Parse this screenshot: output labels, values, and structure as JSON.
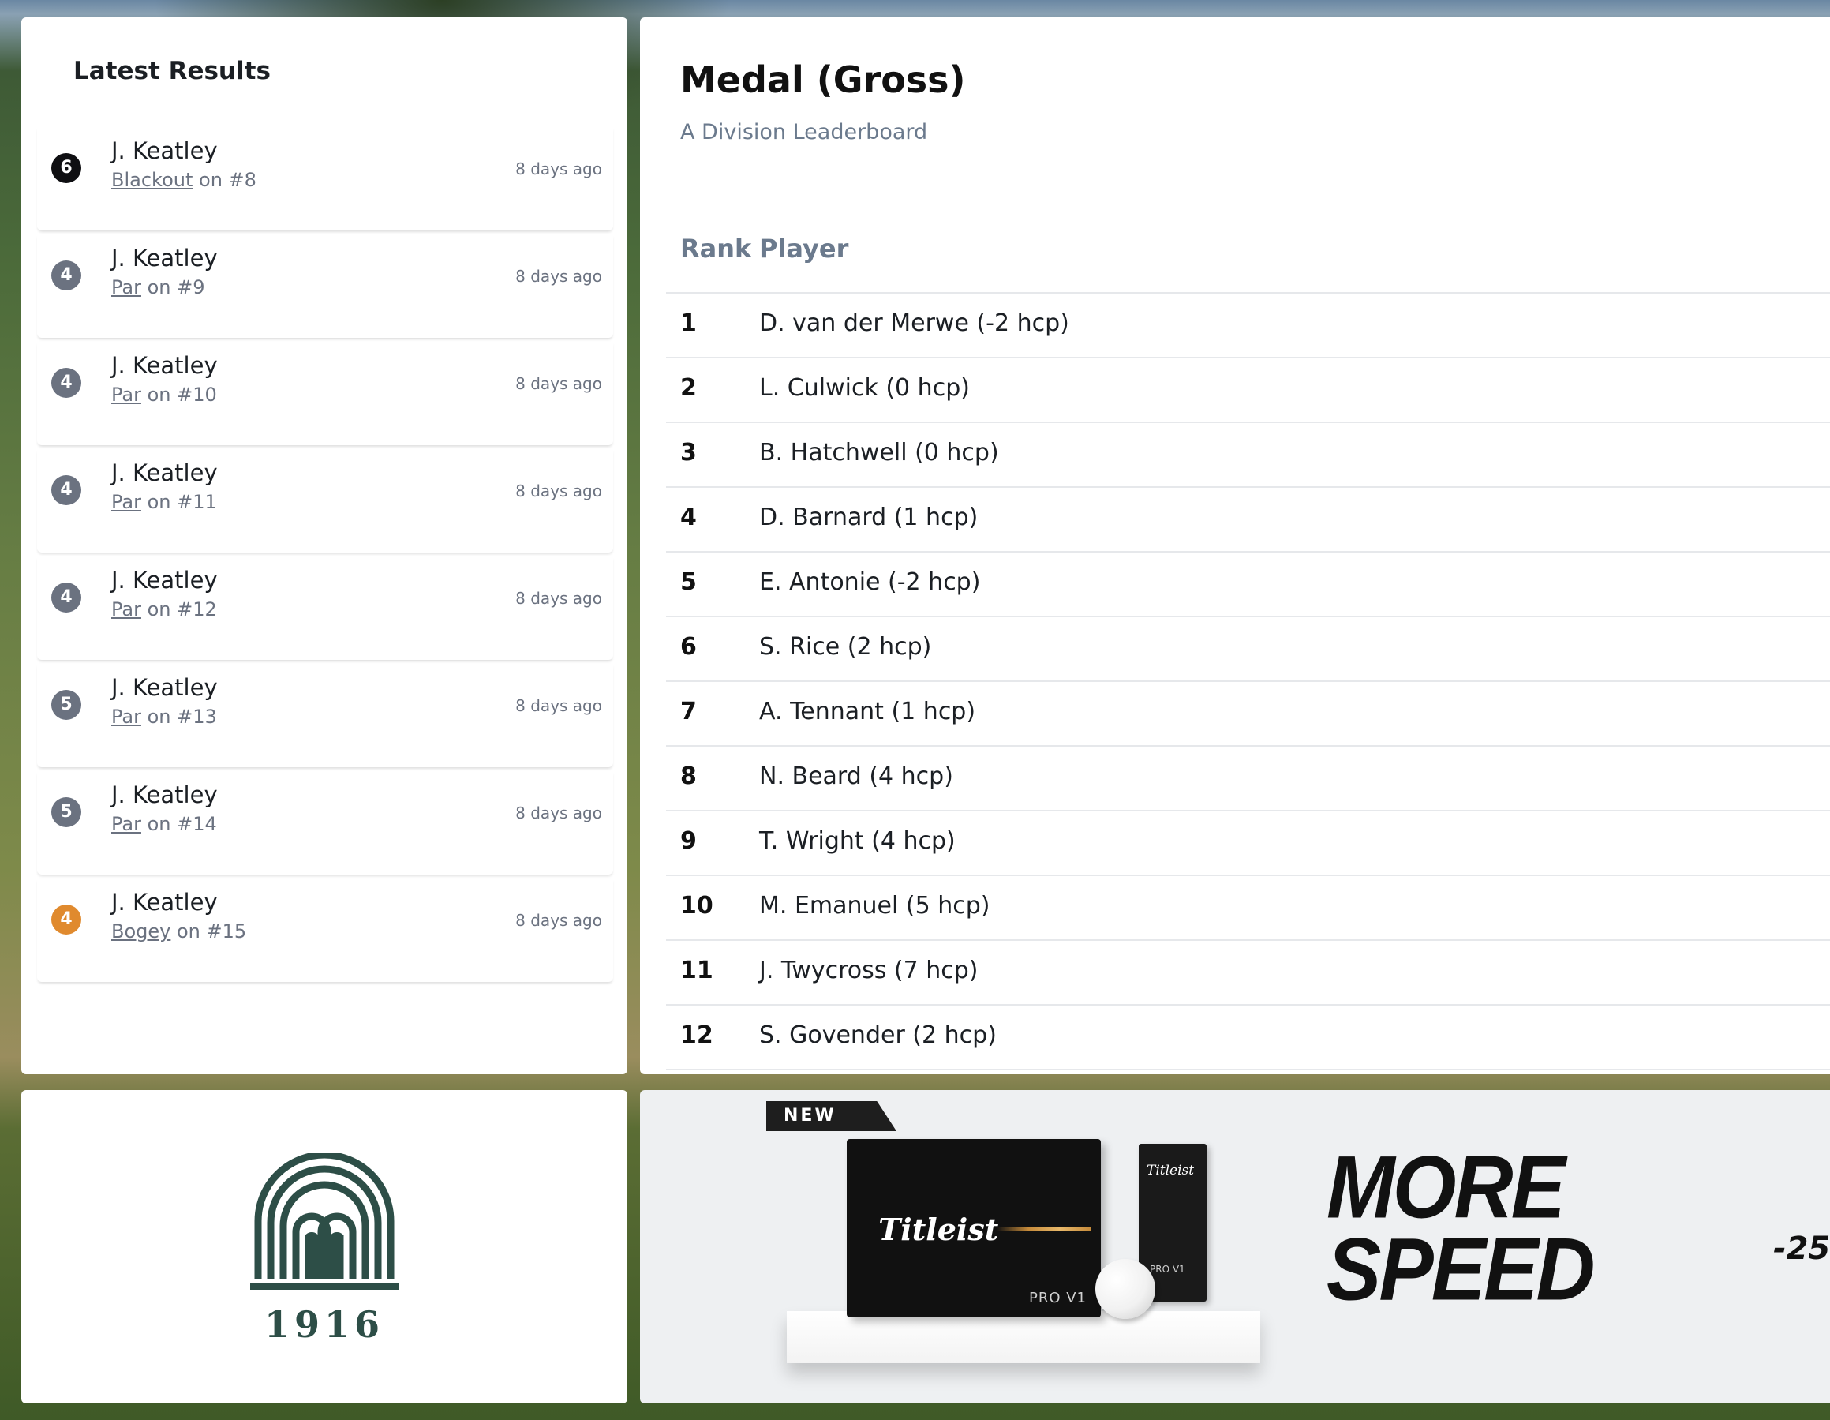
{
  "latest_results": {
    "title": "Latest Results",
    "items": [
      {
        "score": "6",
        "badge_color": "#0f0f12",
        "player": "J. Keatley",
        "result": "Blackout",
        "hole": "on #8",
        "time": "8 days ago"
      },
      {
        "score": "4",
        "badge_color": "#6b7280",
        "player": "J. Keatley",
        "result": "Par",
        "hole": "on #9",
        "time": "8 days ago"
      },
      {
        "score": "4",
        "badge_color": "#6b7280",
        "player": "J. Keatley",
        "result": "Par",
        "hole": "on #10",
        "time": "8 days ago"
      },
      {
        "score": "4",
        "badge_color": "#6b7280",
        "player": "J. Keatley",
        "result": "Par",
        "hole": "on #11",
        "time": "8 days ago"
      },
      {
        "score": "4",
        "badge_color": "#6b7280",
        "player": "J. Keatley",
        "result": "Par",
        "hole": "on #12",
        "time": "8 days ago"
      },
      {
        "score": "5",
        "badge_color": "#6b7280",
        "player": "J. Keatley",
        "result": "Par",
        "hole": "on #13",
        "time": "8 days ago"
      },
      {
        "score": "5",
        "badge_color": "#6b7280",
        "player": "J. Keatley",
        "result": "Par",
        "hole": "on #14",
        "time": "8 days ago"
      },
      {
        "score": "4",
        "badge_color": "#e08a2e",
        "player": "J. Keatley",
        "result": "Bogey",
        "hole": "on #15",
        "time": "8 days ago"
      }
    ]
  },
  "leaderboard": {
    "title": "Medal (Gross)",
    "subtitle": "A Division Leaderboard",
    "columns": {
      "rank": "Rank",
      "player": "Player"
    },
    "rows": [
      {
        "rank": "1",
        "player": "D. van der Merwe (-2 hcp)"
      },
      {
        "rank": "2",
        "player": "L. Culwick (0 hcp)"
      },
      {
        "rank": "3",
        "player": "B. Hatchwell (0 hcp)"
      },
      {
        "rank": "4",
        "player": "D. Barnard (1 hcp)"
      },
      {
        "rank": "5",
        "player": "E. Antonie (-2 hcp)"
      },
      {
        "rank": "6",
        "player": "S. Rice (2 hcp)"
      },
      {
        "rank": "7",
        "player": "A. Tennant (1 hcp)"
      },
      {
        "rank": "8",
        "player": "N. Beard (4 hcp)"
      },
      {
        "rank": "9",
        "player": "T. Wright (4 hcp)"
      },
      {
        "rank": "10",
        "player": "M. Emanuel (5 hcp)"
      },
      {
        "rank": "11",
        "player": "J. Twycross (7 hcp)"
      },
      {
        "rank": "12",
        "player": "S. Govender (2 hcp)"
      }
    ]
  },
  "club_logo": {
    "icon": "club-arches-icon",
    "year": "1916",
    "color": "#2d4e47"
  },
  "ad": {
    "tag": "NEW",
    "box_brand": "Titleist",
    "box_model": "PRO V1",
    "sleeve_brand": "Titleist",
    "sleeve_model": "PRO V1",
    "headline_line1": "MORE",
    "headline_line2": "SPEED",
    "edge_logo": "-25"
  }
}
